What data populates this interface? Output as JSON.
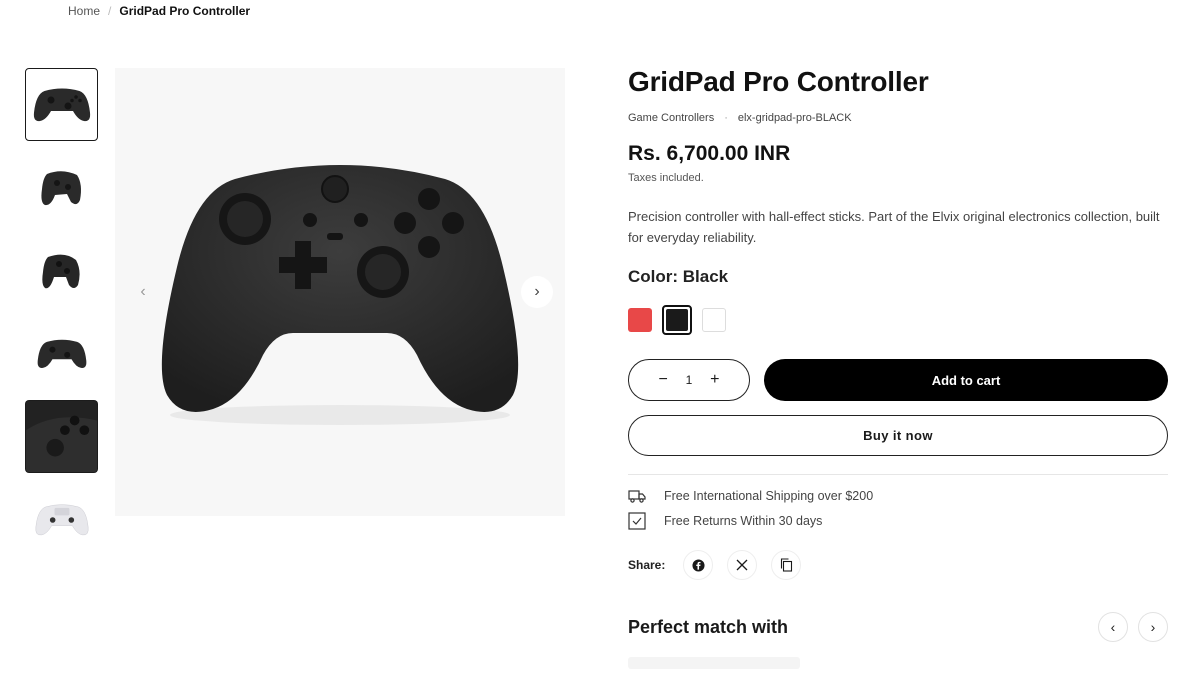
{
  "breadcrumb": {
    "home": "Home",
    "separator": "/",
    "current": "GridPad Pro Controller"
  },
  "product": {
    "title": "GridPad Pro Controller",
    "category": "Game Controllers",
    "meta_separator": "·",
    "sku": "elx-gridpad-pro-BLACK",
    "price": "Rs. 6,700.00 INR",
    "taxes": "Taxes included.",
    "description": "Precision controller with hall-effect sticks. Part of the Elvix original electronics collection, built for everyday reliability.",
    "color_label": "Color: Black",
    "swatches": [
      {
        "name": "Red",
        "color": "#e84848"
      },
      {
        "name": "Black",
        "color": "#1a1a1a",
        "selected": true
      },
      {
        "name": "White",
        "color": "#ffffff"
      }
    ],
    "quantity": "1",
    "quantity_decrease": "−",
    "quantity_increase": "+",
    "add_to_cart": "Add to cart",
    "buy_now": "Buy it now"
  },
  "gallery": {
    "thumbnail_count": 6,
    "prev_icon": "chevron-left-icon",
    "next_icon": "chevron-right-icon"
  },
  "perks": [
    {
      "icon": "truck-icon",
      "text": "Free International Shipping over $200"
    },
    {
      "icon": "checkbox-icon",
      "text": "Free Returns Within 30 days"
    }
  ],
  "share": {
    "label": "Share:",
    "buttons": [
      "facebook-icon",
      "x-icon",
      "copy-icon"
    ]
  },
  "related": {
    "title": "Perfect match with",
    "prev": "‹",
    "next": "›"
  },
  "colors": {
    "accent": "#000000",
    "text": "#1a1a1a",
    "muted": "#444444"
  }
}
